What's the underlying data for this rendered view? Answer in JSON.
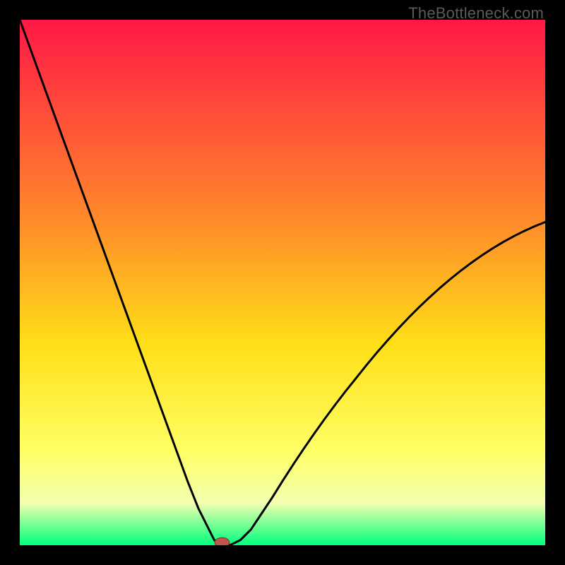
{
  "watermark": "TheBottleneck.com",
  "colors": {
    "frame": "#000000",
    "gradient_top": "#ff1846",
    "gradient_mid1": "#ff8a2a",
    "gradient_mid2": "#ffe018",
    "gradient_mid3": "#ffff66",
    "gradient_mid4": "#f2ffb0",
    "gradient_bottom": "#00ff7e",
    "curve": "#000000",
    "marker_fill": "#c1554b",
    "marker_stroke": "#7a2f29"
  },
  "chart_data": {
    "type": "line",
    "title": "",
    "xlabel": "",
    "ylabel": "",
    "xlim": [
      0,
      100
    ],
    "ylim": [
      0,
      100
    ],
    "x": [
      0,
      2,
      4,
      6,
      8,
      10,
      12,
      14,
      16,
      18,
      20,
      22,
      24,
      26,
      28,
      30,
      32,
      34,
      36,
      37,
      38,
      38.5,
      39,
      40,
      42,
      44,
      46,
      48,
      50,
      52,
      54,
      56,
      58,
      60,
      62,
      64,
      66,
      68,
      70,
      72,
      74,
      76,
      78,
      80,
      82,
      84,
      86,
      88,
      90,
      92,
      94,
      96,
      98,
      100
    ],
    "values": [
      100,
      94.5,
      89,
      83.5,
      78,
      72.5,
      67,
      61.5,
      56,
      50.5,
      45,
      39.5,
      34,
      28.5,
      23,
      17.5,
      12,
      7,
      3,
      1,
      0,
      0,
      0,
      0,
      1,
      3,
      6,
      9,
      12.2,
      15.3,
      18.3,
      21.2,
      24,
      26.7,
      29.3,
      31.8,
      34.3,
      36.7,
      39,
      41.2,
      43.3,
      45.3,
      47.2,
      49,
      50.7,
      52.3,
      53.8,
      55.2,
      56.5,
      57.7,
      58.8,
      59.8,
      60.7,
      61.5
    ],
    "flat_segment_x": [
      37,
      40
    ],
    "marker": {
      "x": 38.5,
      "y": 0,
      "rx": 1.4,
      "ry": 0.9
    },
    "annotations": []
  }
}
